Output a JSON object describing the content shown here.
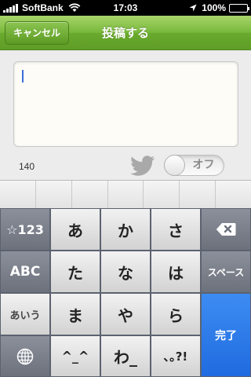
{
  "status_bar": {
    "carrier": "SoftBank",
    "time": "17:03",
    "battery": "100%",
    "battery_level": 1.0
  },
  "nav": {
    "cancel_label": "キャンセル",
    "title": "投稿する"
  },
  "compose": {
    "text": "",
    "char_count": "140",
    "toggle_label": "オフ"
  },
  "keyboard": {
    "rows": [
      [
        "☆123",
        "あ",
        "か",
        "さ",
        "delete"
      ],
      [
        "ABC",
        "た",
        "な",
        "は",
        "スペース"
      ],
      [
        "あいう",
        "ま",
        "や",
        "ら",
        "完了"
      ],
      [
        "globe",
        "^_^",
        "わ_",
        "､｡?!"
      ]
    ],
    "labels": {
      "k_123": "☆123",
      "k_a": "あ",
      "k_ka": "か",
      "k_sa": "さ",
      "k_abc": "ABC",
      "k_ta": "た",
      "k_na": "な",
      "k_ha": "は",
      "k_space": "スペース",
      "k_aiu": "あいう",
      "k_ma": "ま",
      "k_ya": "や",
      "k_ra": "ら",
      "k_done": "完了",
      "k_kaomoji": "^_^",
      "k_wa": "わ_",
      "k_punct": "､｡?!"
    }
  },
  "colors": {
    "nav_green": "#77b83a",
    "done_blue": "#1f6be0"
  }
}
